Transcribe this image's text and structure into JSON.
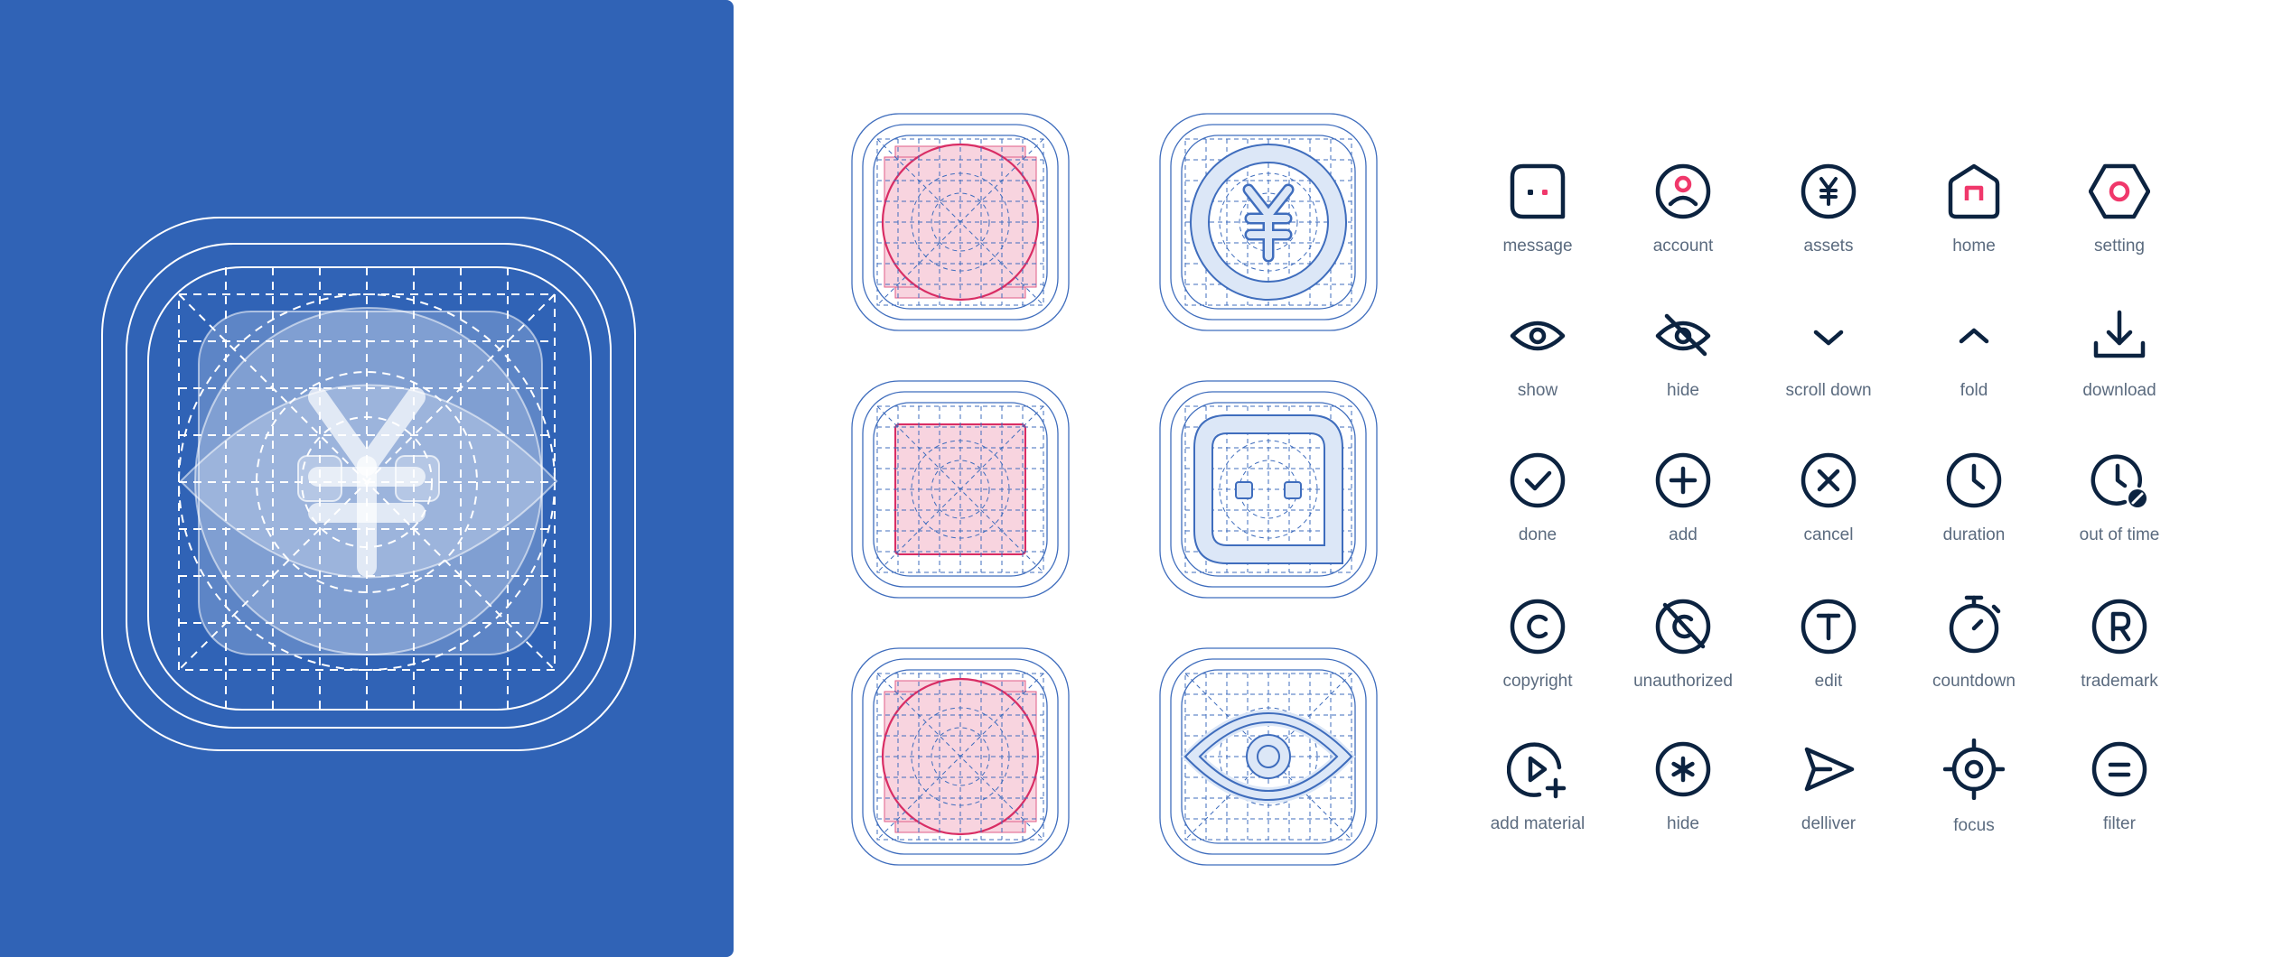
{
  "colors": {
    "panel_blue": "#3063b6",
    "grid_blue": "#3f6dbd",
    "icon_navy": "#0c2340",
    "accent_pink": "#f0386b",
    "label_gray": "#5b6b7f",
    "keyline_fill": "#f8d4df"
  },
  "icons": [
    {
      "name": "message-icon",
      "label": "message"
    },
    {
      "name": "account-icon",
      "label": "account"
    },
    {
      "name": "assets-icon",
      "label": "assets"
    },
    {
      "name": "home-icon",
      "label": "home"
    },
    {
      "name": "setting-icon",
      "label": "setting"
    },
    {
      "name": "show-icon",
      "label": "show"
    },
    {
      "name": "hide-icon",
      "label": "hide"
    },
    {
      "name": "scroll-down-icon",
      "label": "scroll down"
    },
    {
      "name": "fold-icon",
      "label": "fold"
    },
    {
      "name": "download-icon",
      "label": "download"
    },
    {
      "name": "done-icon",
      "label": "done"
    },
    {
      "name": "add-icon",
      "label": "add"
    },
    {
      "name": "cancel-icon",
      "label": "cancel"
    },
    {
      "name": "duration-icon",
      "label": "duration"
    },
    {
      "name": "out-of-time-icon",
      "label": "out of time"
    },
    {
      "name": "copyright-icon",
      "label": "copyright"
    },
    {
      "name": "unauthorized-icon",
      "label": "unauthorized"
    },
    {
      "name": "edit-icon",
      "label": "edit"
    },
    {
      "name": "countdown-icon",
      "label": "countdown"
    },
    {
      "name": "trademark-icon",
      "label": "trademark"
    },
    {
      "name": "add-material-icon",
      "label": "add material"
    },
    {
      "name": "asterisk-hide-icon",
      "label": "hide"
    },
    {
      "name": "deliver-icon",
      "label": "delliver"
    },
    {
      "name": "focus-icon",
      "label": "focus"
    },
    {
      "name": "filter-icon",
      "label": "filter"
    }
  ]
}
